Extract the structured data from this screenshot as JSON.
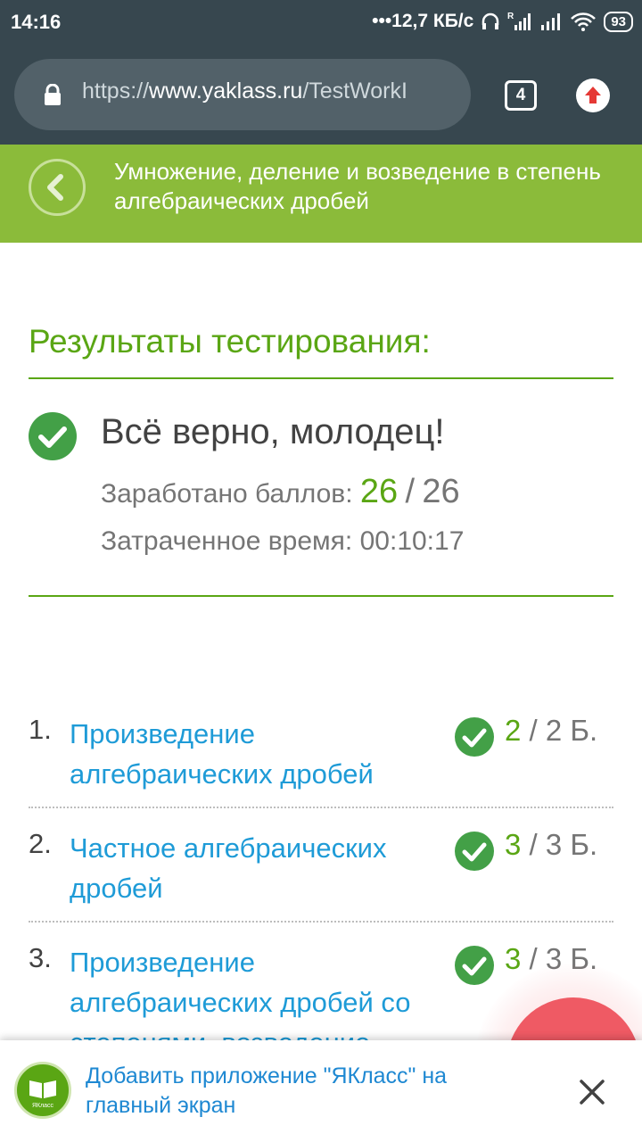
{
  "status_bar": {
    "time": "14:16",
    "speed": "12,7 КБ/с",
    "battery": "93"
  },
  "browser": {
    "url_scheme": "https://",
    "url_host": "www.yaklass.ru",
    "url_path": "/TestWorkI",
    "tab_count": "4"
  },
  "header": {
    "topic_title": "Умножение, деление и возведение в степень алгебраических дробей"
  },
  "results": {
    "title": "Результаты тестирования:",
    "message": "Всё верно, молодец!",
    "score_label": "Заработано баллов:",
    "score_earned": "26",
    "score_separator": "/",
    "score_total": "26",
    "time_label": "Затраченное время:",
    "time_value": "00:10:17"
  },
  "tasks": [
    {
      "num": "1.",
      "title": "Произведение алгебраических дробей",
      "got": "2",
      "sep": " / ",
      "max": "2 Б."
    },
    {
      "num": "2.",
      "title": "Частное алгебраических дробей",
      "got": "3",
      "sep": " / ",
      "max": "3 Б."
    },
    {
      "num": "3.",
      "title": "Произведение алгебраических дробей со степенями, возведение",
      "got": "3",
      "sep": " / ",
      "max": "3 Б."
    }
  ],
  "banner": {
    "logo_label": "ЯКласс",
    "text": "Добавить приложение \"ЯКласс\" на главный экран"
  },
  "colors": {
    "header_green": "#8bbb3a",
    "accent_green": "#5aa614",
    "link_blue": "#1e9bd7",
    "toolbar": "#37474f"
  }
}
